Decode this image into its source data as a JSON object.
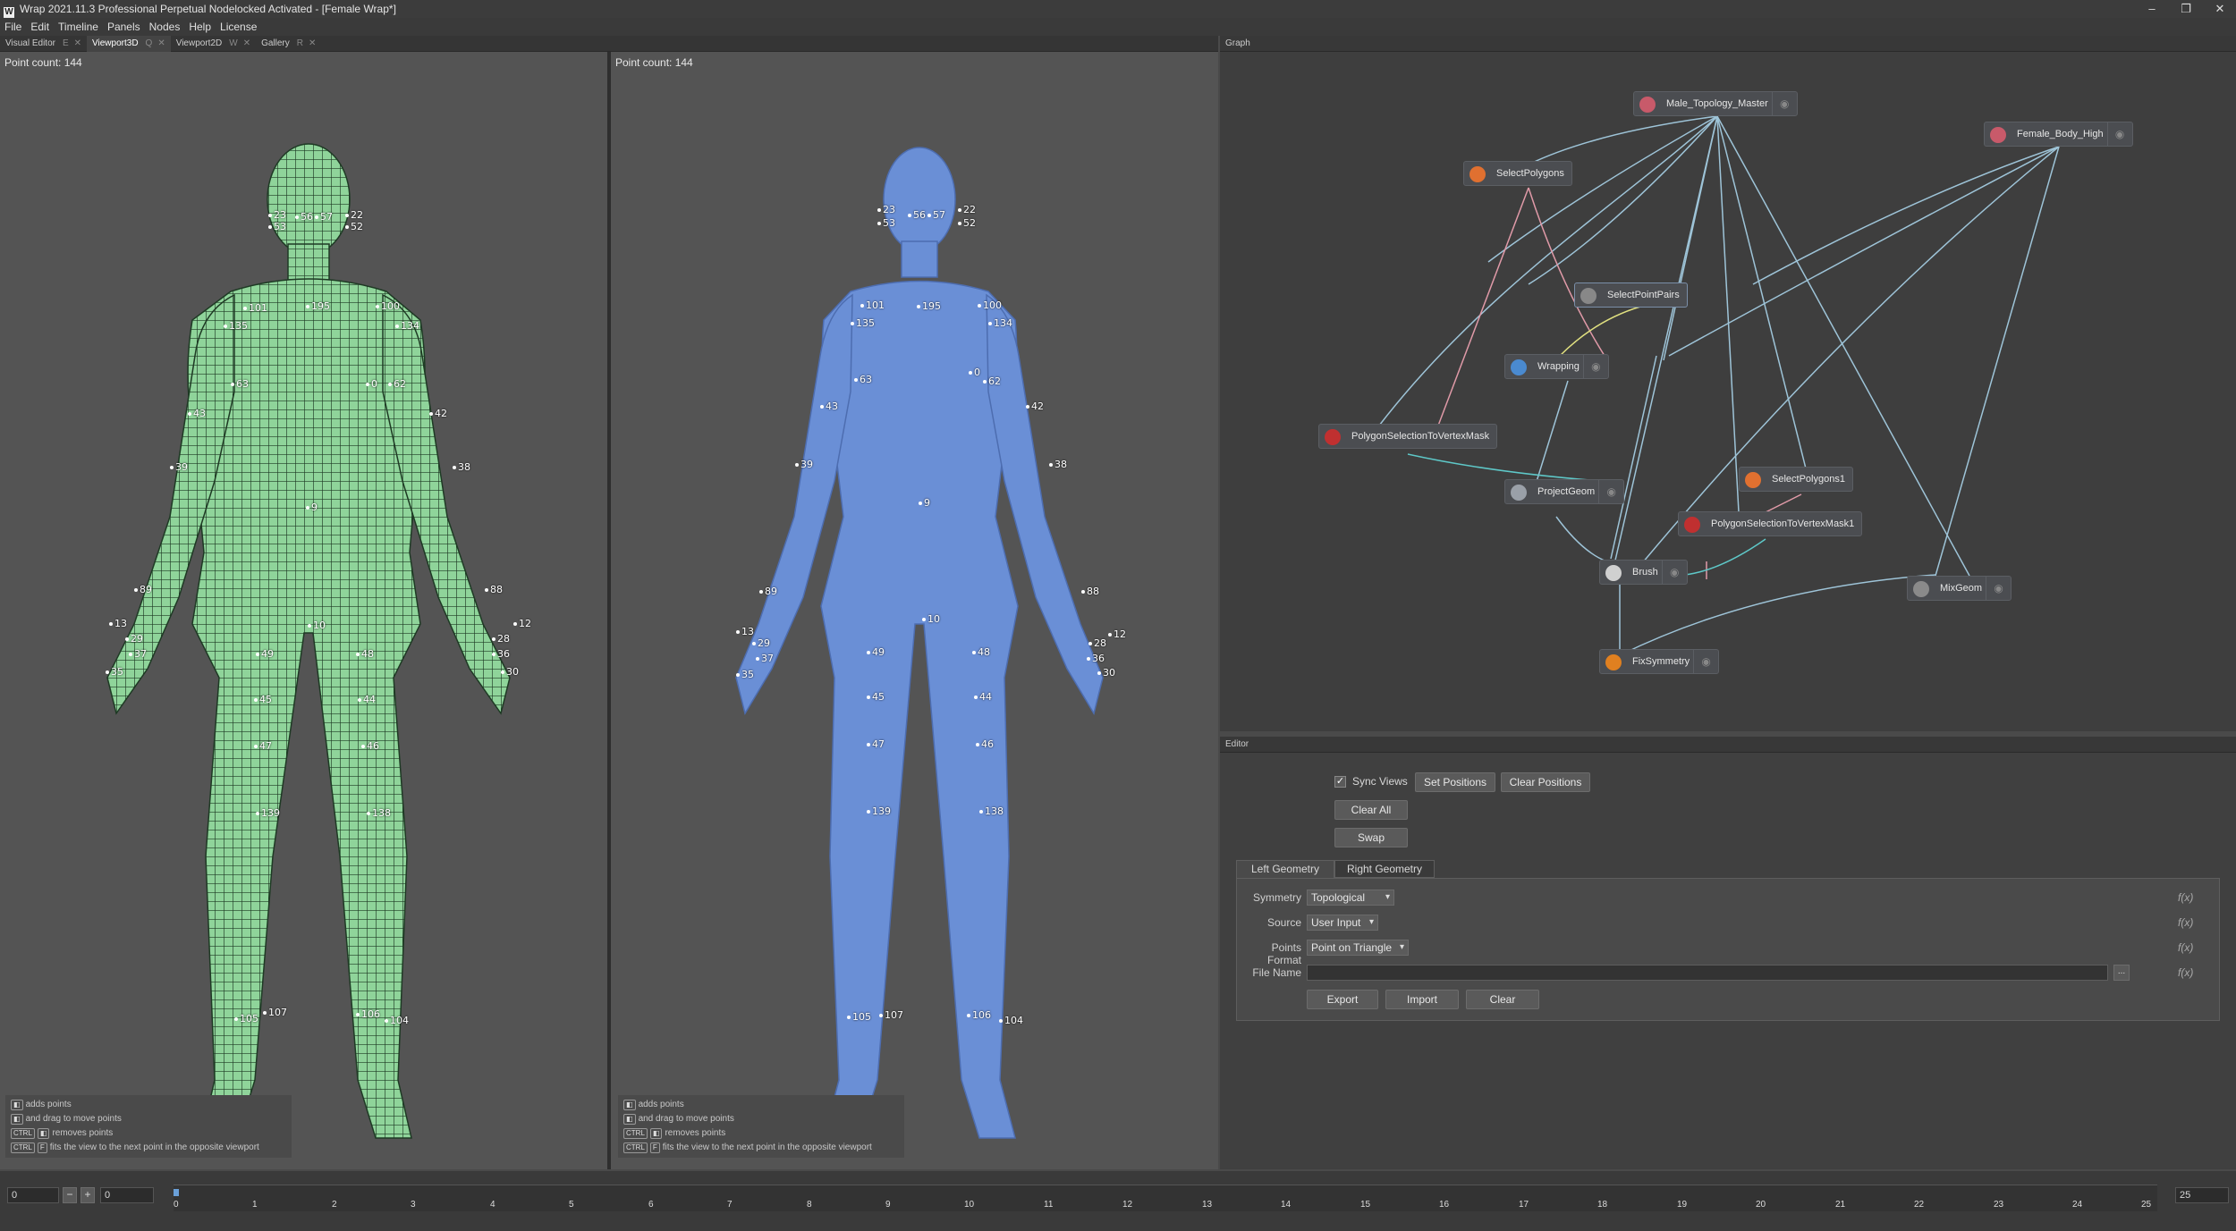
{
  "window": {
    "title": "Wrap 2021.11.3  Professional Perpetual Nodelocked Activated - [Female Wrap*]",
    "logo": "W",
    "minimize": "–",
    "maximize": "❐",
    "close": "✕"
  },
  "menu": [
    "File",
    "Edit",
    "Timeline",
    "Panels",
    "Nodes",
    "Help",
    "License"
  ],
  "tabs": [
    {
      "label": "Visual Editor",
      "key": "E"
    },
    {
      "label": "Viewport3D",
      "key": "Q"
    },
    {
      "label": "Viewport2D",
      "key": "W"
    },
    {
      "label": "Gallery",
      "key": "R"
    }
  ],
  "left_viewport": {
    "point_count": "Point count: 144"
  },
  "right_viewport": {
    "point_count": "Point count: 144"
  },
  "landmarks_body": [
    "101",
    "195",
    "100",
    "135",
    "134",
    "63",
    "0",
    "62",
    "43",
    "42",
    "39",
    "38",
    "9",
    "89",
    "88",
    "13",
    "12",
    "29",
    "28",
    "37",
    "36",
    "35",
    "30",
    "10",
    "49",
    "48",
    "45",
    "44",
    "47",
    "46",
    "139",
    "138",
    "105",
    "107",
    "106",
    "104",
    "22",
    "23",
    "52",
    "53",
    "57",
    "56"
  ],
  "hints": [
    {
      "key": "",
      "text": "adds points"
    },
    {
      "key": "",
      "text": "and drag to move points"
    },
    {
      "key": "CTRL + ",
      "text": "removes points"
    },
    {
      "key": "CTRL + F",
      "text": "fits the view to the next point in the opposite viewport"
    }
  ],
  "graph": {
    "title": "Graph",
    "nodes": [
      {
        "label": "Male_Topology_Master",
        "icon": "mesh-icon",
        "color": "#c85a6a"
      },
      {
        "label": "Female_Body_High",
        "icon": "mesh-icon",
        "color": "#c85a6a"
      },
      {
        "label": "SelectPolygons",
        "icon": "select-icon",
        "color": "#e07030"
      },
      {
        "label": "SelectPointPairs",
        "icon": "pairs-icon",
        "color": "#888"
      },
      {
        "label": "Wrapping",
        "icon": "wrap-icon",
        "color": "#4a8ad0"
      },
      {
        "label": "PolygonSelectionToVertexMask",
        "icon": "mask-icon",
        "color": "#c03030"
      },
      {
        "label": "ProjectGeom",
        "icon": "project-icon",
        "color": "#9aa0a8"
      },
      {
        "label": "SelectPolygons1",
        "icon": "select-icon",
        "color": "#e07030"
      },
      {
        "label": "PolygonSelectionToVertexMask1",
        "icon": "mask-icon",
        "color": "#c03030"
      },
      {
        "label": "Brush",
        "icon": "brush-icon",
        "color": "#d0d0d0"
      },
      {
        "label": "MixGeom",
        "icon": "mix-icon",
        "color": "#8a8a8a"
      },
      {
        "label": "FixSymmetry",
        "icon": "symmetry-icon",
        "color": "#e08020"
      }
    ]
  },
  "editor": {
    "title": "Editor",
    "sync_views": "Sync Views",
    "set_positions": "Set Positions",
    "clear_positions": "Clear Positions",
    "clear_all": "Clear All",
    "swap": "Swap",
    "tab_left": "Left Geometry",
    "tab_right": "Right Geometry",
    "symmetry_label": "Symmetry",
    "symmetry_value": "Topological",
    "source_label": "Source",
    "source_value": "User Input",
    "points_format_label": "Points Format",
    "points_format_value": "Point on Triangle",
    "file_name_label": "File Name",
    "file_name_value": "",
    "browse": "...",
    "export": "Export",
    "import": "Import",
    "clear": "Clear",
    "fx": "f(x)"
  },
  "timeline": {
    "start": "0",
    "current": "0",
    "end": "25",
    "ticks": [
      "0",
      "1",
      "2",
      "3",
      "4",
      "5",
      "6",
      "7",
      "8",
      "9",
      "10",
      "11",
      "12",
      "13",
      "14",
      "15",
      "16",
      "17",
      "18",
      "19",
      "20",
      "21",
      "22",
      "23",
      "24",
      "25"
    ]
  }
}
